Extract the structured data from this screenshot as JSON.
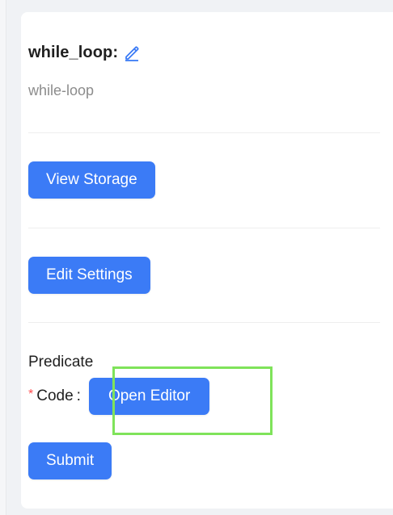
{
  "node": {
    "title": "while_loop:",
    "subtitle": "while-loop"
  },
  "buttons": {
    "view_storage": "View Storage",
    "edit_settings": "Edit Settings",
    "open_editor": "Open Editor",
    "submit": "Submit"
  },
  "form": {
    "section_label": "Predicate",
    "required_marker": "*",
    "code_label": "Code",
    "code_separator": ":"
  },
  "icons": {
    "edit": "pencil-icon"
  },
  "colors": {
    "primary": "#3b7bf6",
    "highlight": "#7fe35a",
    "required": "#ff4d4f"
  }
}
